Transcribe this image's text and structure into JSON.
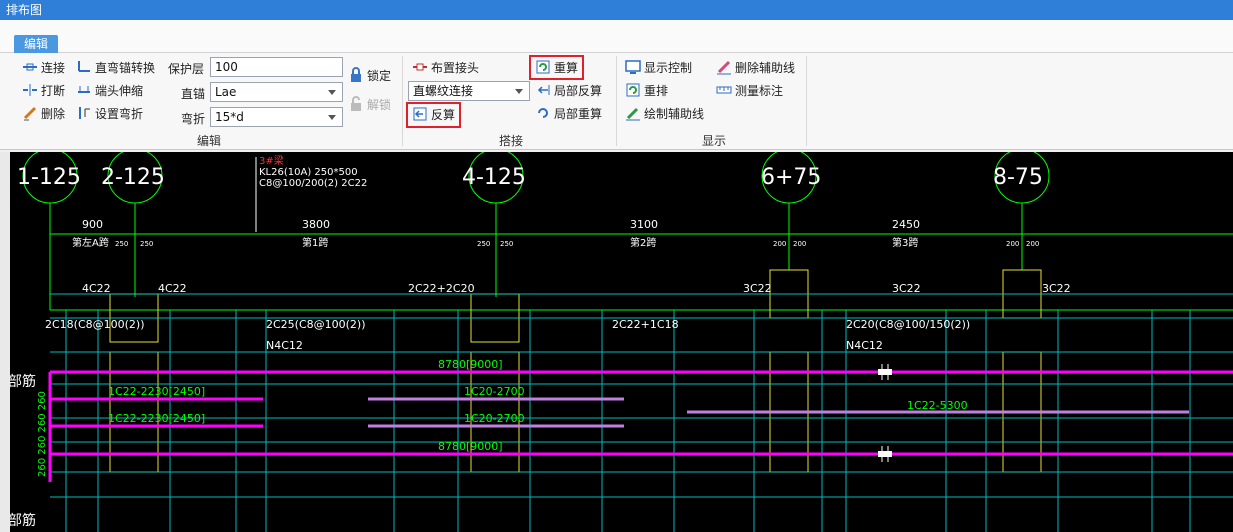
{
  "window": {
    "title": "排布图"
  },
  "ribbon": {
    "tab": "编辑",
    "edit": {
      "connect": "连接",
      "break": "打断",
      "delete": "删除",
      "straight_bend_convert": "直弯锚转换",
      "end_stretch": "端头伸缩",
      "set_bend": "设置弯折",
      "cover_label": "保护层",
      "cover_value": "100",
      "anchor_label": "直锚",
      "anchor_value": "Lae",
      "bend_label": "弯折",
      "bend_value": "15*d",
      "lock": "锁定",
      "unlock": "解锁",
      "group": "编辑"
    },
    "splice": {
      "place_joint": "布置接头",
      "joint_type": "直螺纹连接",
      "reverse_calc": "反算",
      "recalc": "重算",
      "local_reverse": "局部反算",
      "local_recalc": "局部重算",
      "group": "搭接"
    },
    "display": {
      "display_control": "显示控制",
      "rearrange": "重排",
      "draw_aux": "绘制辅助线",
      "delete_aux": "删除辅助线",
      "measure": "测量标注",
      "group": "显示"
    }
  },
  "drawing": {
    "axes": [
      "1-125",
      "2-125",
      "4-125",
      "6+75",
      "8-75"
    ],
    "beam_label": "3#梁",
    "beam_info_1": "KL26(10A) 250*500",
    "beam_info_2": "C8@100/200(2) 2C22",
    "dims": [
      "900",
      "3800",
      "3100",
      "2450"
    ],
    "spans": [
      "第左A跨",
      "第1跨",
      "第2跨",
      "第3跨"
    ],
    "col_dims": [
      "250",
      "250",
      "250",
      "250",
      "200",
      "200",
      "200",
      "200"
    ],
    "top_bars": [
      "4C22",
      "4C22",
      "2C22+2C20",
      "3C22",
      "3C22",
      "3C22"
    ],
    "stirrups": [
      "2C18(C8@100(2))",
      "2C25(C8@100(2))",
      "2C22+1C18",
      "2C20(C8@100/150(2))"
    ],
    "waist": [
      "N4C12",
      "N4C12"
    ],
    "rebar_lengths": [
      "8780[9000]",
      "1C22-2230[2450]",
      "1C20-2700",
      "1C22-2230[2450]",
      "1C20-2700",
      "1C22-5300",
      "8780[9000]"
    ],
    "side_labels": [
      "部筋",
      "部筋"
    ],
    "vertical_dims": "260  260  260  260",
    "colors": {
      "background": "#000000",
      "green": "#00ff00",
      "cyan": "#00d0d0",
      "magenta": "#ff00ff",
      "violet": "#c080e0",
      "yellow": "#e8e030",
      "white": "#ffffff",
      "red": "#ff3030"
    }
  }
}
